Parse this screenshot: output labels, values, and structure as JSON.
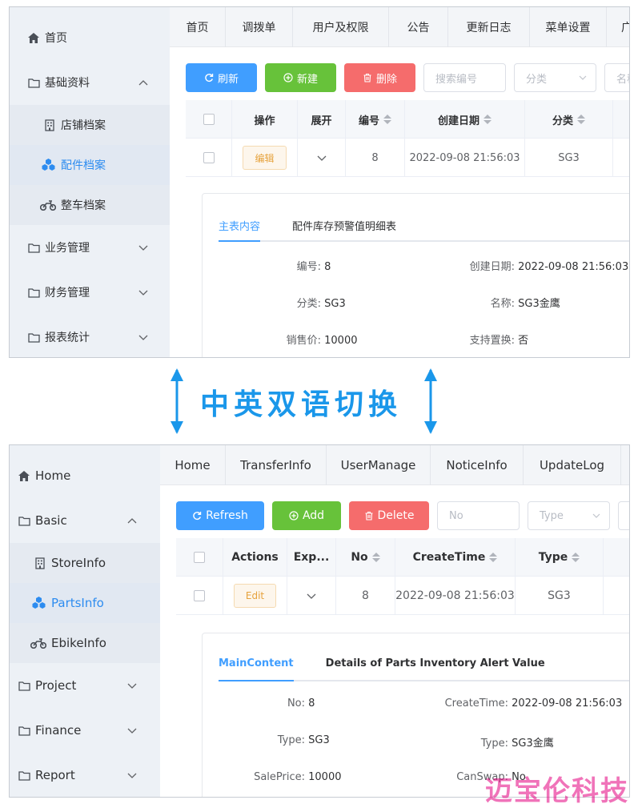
{
  "top": {
    "sidebar": {
      "items": [
        {
          "label": "首页",
          "icon": "home-icon"
        },
        {
          "label": "基础资料",
          "icon": "folder-icon",
          "expanded": true
        },
        {
          "label": "店铺档案",
          "icon": "building-icon"
        },
        {
          "label": "配件档案",
          "icon": "cubes-icon",
          "active": true
        },
        {
          "label": "整车档案",
          "icon": "motorcycle-icon"
        },
        {
          "label": "业务管理",
          "icon": "folder-icon"
        },
        {
          "label": "财务管理",
          "icon": "folder-icon"
        },
        {
          "label": "报表统计",
          "icon": "folder-icon"
        }
      ]
    },
    "tabs": [
      "首页",
      "调拨单",
      "用户及权限",
      "公告",
      "更新日志",
      "菜单设置",
      "广"
    ],
    "toolbar": {
      "refresh": "刷新",
      "add": "新建",
      "delete": "删除",
      "search_placeholder": "搜索编号",
      "type_placeholder": "分类",
      "name_placeholder": "名称"
    },
    "table": {
      "headers": [
        "操作",
        "展开",
        "编号",
        "创建日期",
        "分类"
      ],
      "row": {
        "edit": "编辑",
        "no": "8",
        "create_time": "2022-09-08 21:56:03",
        "type": "SG3"
      }
    },
    "detail": {
      "tabs": [
        "主表内容",
        "配件库存预警值明细表"
      ],
      "fields": [
        {
          "label": "编号:",
          "value": "8"
        },
        {
          "label": "创建日期:",
          "value": "2022-09-08 21:56:03"
        },
        {
          "label": "分类:",
          "value": "SG3"
        },
        {
          "label": "名称:",
          "value": "SG3金鹰"
        },
        {
          "label": "销售价:",
          "value": "10000"
        },
        {
          "label": "支持置换:",
          "value": "否"
        }
      ]
    }
  },
  "banner": {
    "text": "中英双语切换"
  },
  "bottom": {
    "sidebar": {
      "items": [
        {
          "label": "Home",
          "icon": "home-icon"
        },
        {
          "label": "Basic",
          "icon": "folder-icon",
          "expanded": true
        },
        {
          "label": "StoreInfo",
          "icon": "building-icon"
        },
        {
          "label": "PartsInfo",
          "icon": "cubes-icon",
          "active": true
        },
        {
          "label": "EbikeInfo",
          "icon": "motorcycle-icon"
        },
        {
          "label": "Project",
          "icon": "folder-icon"
        },
        {
          "label": "Finance",
          "icon": "folder-icon"
        },
        {
          "label": "Report",
          "icon": "folder-icon"
        }
      ]
    },
    "tabs": [
      "Home",
      "TransferInfo",
      "UserManage",
      "NoticeInfo",
      "UpdateLog"
    ],
    "toolbar": {
      "refresh": "Refresh",
      "add": "Add",
      "delete": "Delete",
      "search_placeholder": "No",
      "type_placeholder": "Type"
    },
    "table": {
      "headers": [
        "Actions",
        "Exp...",
        "No",
        "CreateTime",
        "Type"
      ],
      "row": {
        "edit": "Edit",
        "no": "8",
        "create_time": "2022-09-08 21:56:03",
        "type": "SG3"
      }
    },
    "detail": {
      "tabs": [
        "MainContent",
        "Details of Parts Inventory Alert Value"
      ],
      "fields": [
        {
          "label": "No:",
          "value": "8"
        },
        {
          "label": "CreateTime:",
          "value": "2022-09-08 21:56:03"
        },
        {
          "label": "Type:",
          "value": "SG3"
        },
        {
          "label": "Type:",
          "value": "SG3金鹰"
        },
        {
          "label": "SalePrice:",
          "value": "10000"
        },
        {
          "label": "CanSwap:",
          "value": "No"
        }
      ]
    }
  },
  "watermark": "迈宝伦科技",
  "colors": {
    "primary": "#409eff",
    "success": "#67c23a",
    "danger": "#f56c6c",
    "warning": "#e6a23c",
    "banner": "#1a97ea"
  }
}
